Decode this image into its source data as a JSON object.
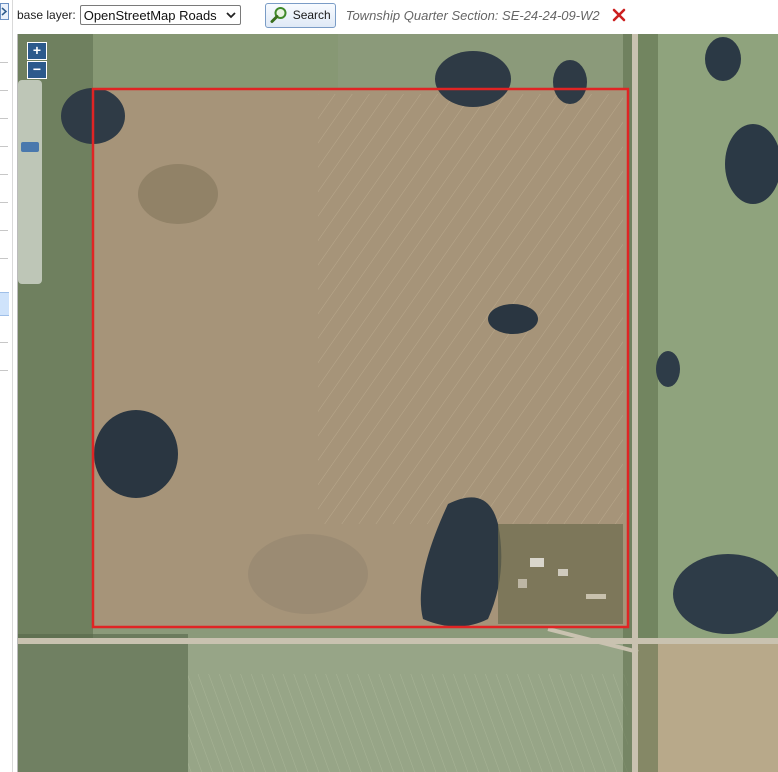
{
  "toolbar": {
    "base_layer_label": "base layer:",
    "base_layer_value": "OpenStreetMap Roads",
    "search_label": "Search",
    "section_title": "Township Quarter Section: SE-24-24-09-W2"
  },
  "map": {
    "zoom_in_label": "+",
    "zoom_out_label": "−",
    "selection_color": "#e02424"
  },
  "icons": {
    "panel_toggle": "chevron-right-icon",
    "search": "magnifier-icon",
    "close": "close-x-icon"
  },
  "colors": {
    "close_icon": "#cc1f1f",
    "zoom_button": "#2c5a8c"
  }
}
